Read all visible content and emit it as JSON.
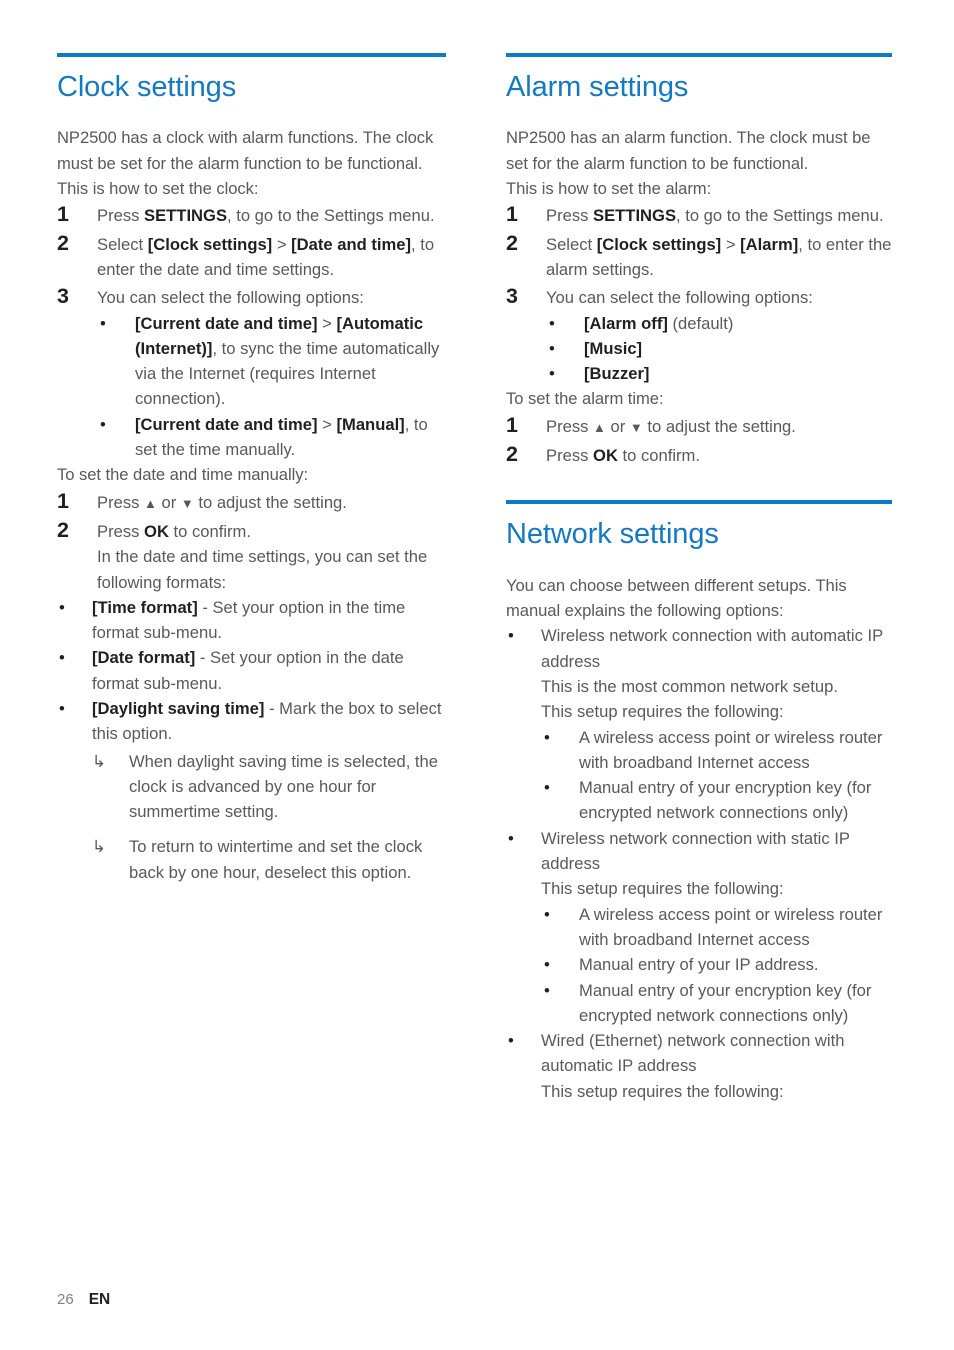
{
  "page": {
    "number": "26",
    "language": "EN",
    "accent_color": "#1479c0",
    "rule_color": "#0f79c5",
    "body_color": "#58595b",
    "bold_color": "#231f20"
  },
  "left_column": {
    "section": {
      "heading": "Clock settings",
      "intro": "NP2500 has a clock with alarm functions. The clock must be set for the alarm function to be functional.",
      "intro2": "This is how to set the clock:",
      "steps": [
        {
          "num": "1",
          "text_parts": [
            "Press ",
            "SETTINGS",
            ", to go to the Settings menu."
          ]
        },
        {
          "num": "2",
          "text_parts": [
            "Select ",
            "[Clock settings]",
            " > ",
            "[Date and time]",
            ", to enter the date and time settings."
          ]
        },
        {
          "num": "3",
          "text": "You can select the following options:",
          "bullets": [
            {
              "parts": [
                "",
                "[Current date and time]",
                " > ",
                "[Automatic (Internet)]",
                ", to sync the time automatically via the Internet (requires Internet connection)."
              ]
            },
            {
              "parts": [
                "",
                "[Current date and time]",
                " > ",
                "[Manual]",
                ", to set the time manually."
              ]
            }
          ]
        }
      ],
      "manual_intro": "To set the date and time manually:",
      "manual_steps": [
        {
          "num": "1",
          "prefix": "Press ",
          "up_arrow": "▲",
          "mid": " or ",
          "down_arrow": "▼",
          "suffix": " to adjust the setting."
        },
        {
          "num": "2",
          "prefix": "Press ",
          "bold": "OK",
          "suffix": " to confirm.",
          "extra": "In the date and time settings, you can set the following formats:"
        }
      ],
      "format_bullets": [
        {
          "bold": "[Time format]",
          "rest": " - Set your option in the time format sub-menu."
        },
        {
          "bold": "[Date format]",
          "rest": " - Set your option in the date format sub-menu."
        },
        {
          "bold": "[Daylight saving time]",
          "rest": " - Mark the box to select this option.",
          "notes": [
            "When daylight saving time is selected, the clock is advanced by one hour for summertime setting.",
            "To return to wintertime and set the clock back by one hour, deselect this option."
          ]
        }
      ]
    }
  },
  "right_column": {
    "alarm_section": {
      "heading": "Alarm settings",
      "intro": "NP2500 has an alarm function. The clock must be set for the alarm function to be functional.",
      "intro2": "This is how to set the alarm:",
      "steps": [
        {
          "num": "1",
          "prefix": "Press ",
          "bold": "SETTINGS",
          "suffix": ", to go to the Settings menu."
        },
        {
          "num": "2",
          "prefix": "Select ",
          "bold1": "[Clock settings]",
          "mid": " > ",
          "bold2": "[Alarm]",
          "suffix": ", to enter the alarm settings."
        },
        {
          "num": "3",
          "text": "You can select the following options:",
          "bullets": [
            {
              "bold": "[Alarm off]",
              "rest": " (default)"
            },
            {
              "bold": "[Music]",
              "rest": ""
            },
            {
              "bold": "[Buzzer]",
              "rest": ""
            }
          ]
        }
      ],
      "alarm_time_intro": "To set the alarm time:",
      "alarm_time_steps": [
        {
          "num": "1",
          "prefix": "Press ",
          "up_arrow": "▲",
          "mid": " or ",
          "down_arrow": "▼",
          "suffix": " to adjust the setting."
        },
        {
          "num": "2",
          "prefix": "Press ",
          "bold": "OK",
          "suffix": " to confirm."
        }
      ]
    },
    "network_section": {
      "heading": "Network settings",
      "intro": "You can choose between different setups. This manual explains the following options:",
      "options": [
        {
          "title": "Wireless network connection with automatic IP address",
          "desc1": "This is the most common network setup.",
          "desc2": "This setup requires the following:",
          "requirements": [
            "A wireless access point or wireless router with broadband Internet access",
            "Manual entry of your encryption key (for encrypted network connections only)"
          ]
        },
        {
          "title": "Wireless network connection with static IP address",
          "desc1": "",
          "desc2": "This setup requires the following:",
          "requirements": [
            "A wireless access point or wireless router with broadband Internet access",
            "Manual entry of your IP address.",
            "Manual entry of your encryption key (for encrypted network connections only)"
          ]
        },
        {
          "title": "Wired (Ethernet) network connection with automatic IP address",
          "desc1": "",
          "desc2": "This setup requires the following:",
          "requirements": []
        }
      ]
    }
  },
  "glyphs": {
    "bullet": "•",
    "arrow_hook": "↳",
    "triangle_up": "▲",
    "triangle_down": "▼"
  }
}
